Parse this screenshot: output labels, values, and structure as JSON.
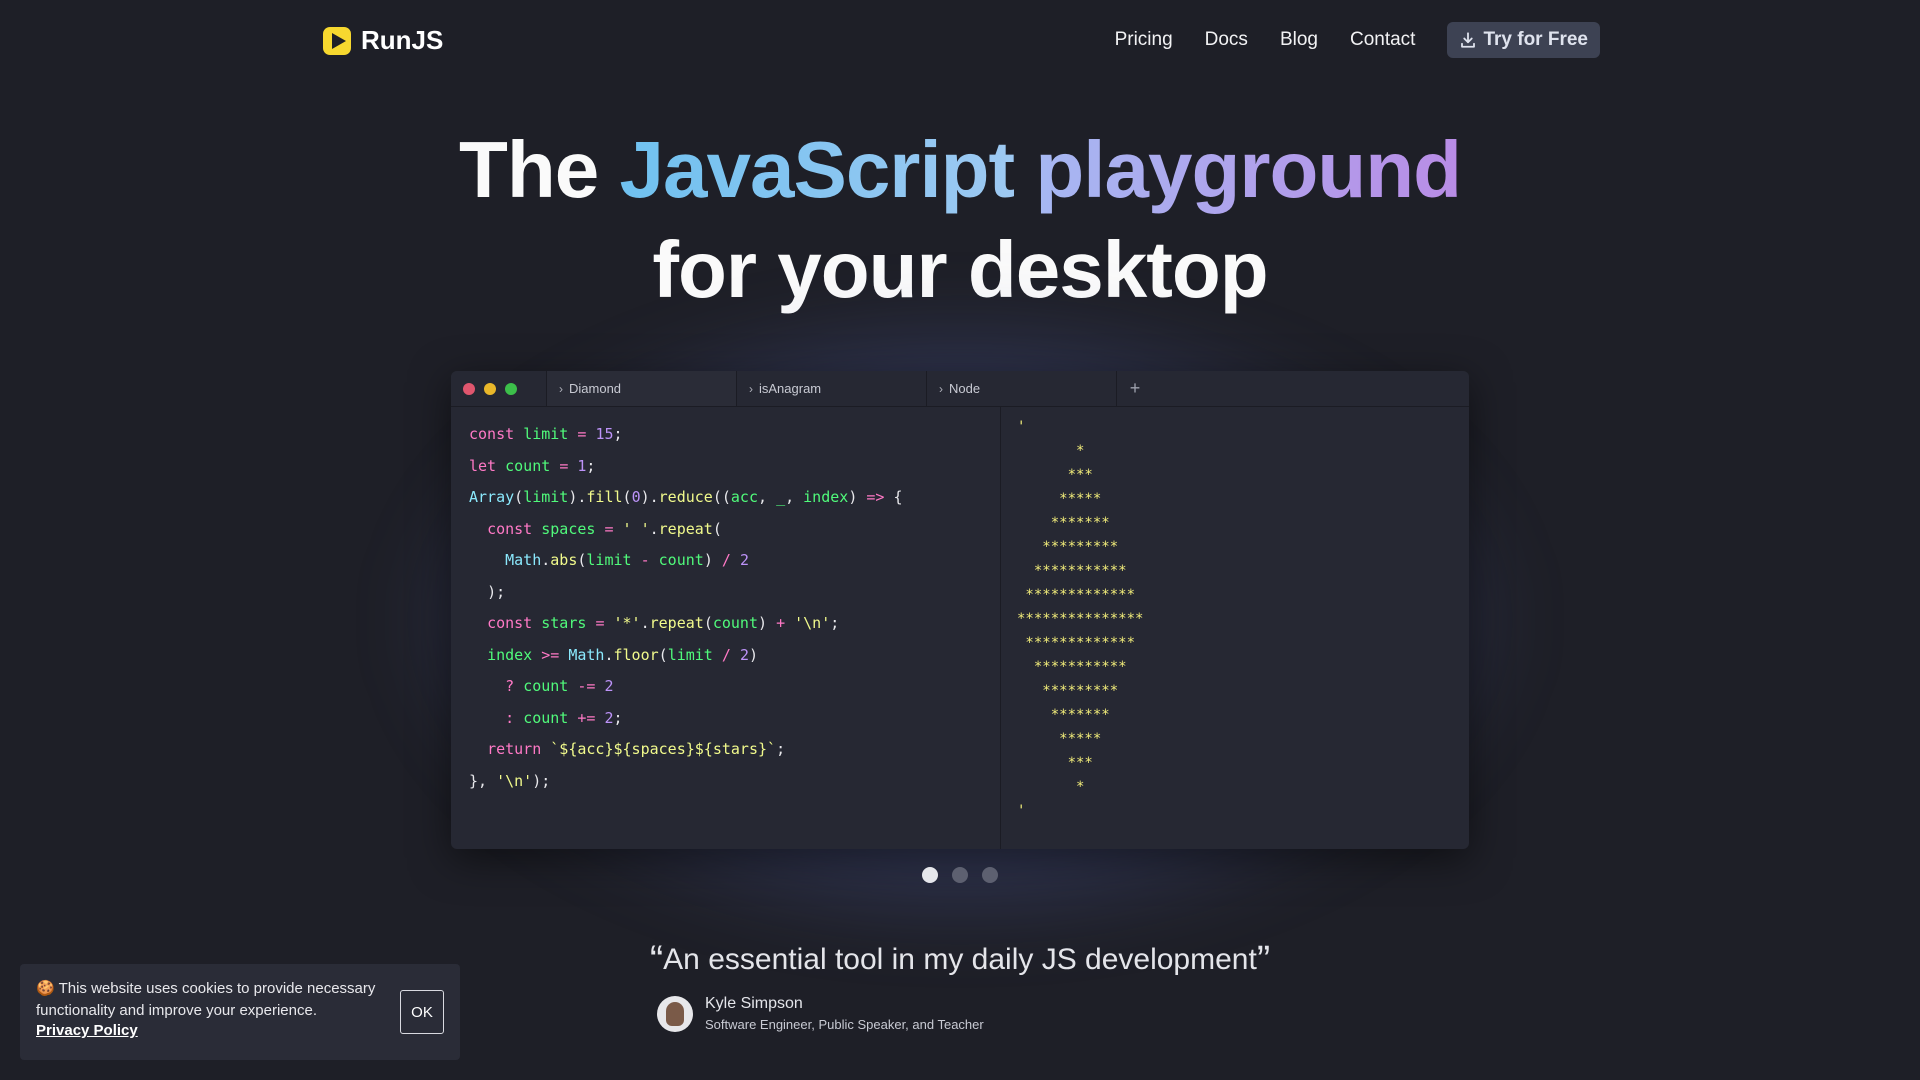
{
  "brand": {
    "name": "RunJS"
  },
  "nav": {
    "links": [
      "Pricing",
      "Docs",
      "Blog",
      "Contact"
    ],
    "cta": "Try for Free"
  },
  "hero": {
    "line1_start": "The ",
    "line1_js": "JavaScript",
    "line1_space": " ",
    "line1_pg": "playground",
    "line2": "for your desktop"
  },
  "app": {
    "window_dots": [
      "#f25f5c",
      "#f6bd29",
      "#3ec44a"
    ],
    "tabs": [
      "Diamond",
      "isAnagram",
      "Node"
    ],
    "add_tab": "+",
    "code_lines": [
      "const limit = 15;",
      "let count = 1;",
      "Array(limit).fill(0).reduce((acc, _, index) => {",
      "  const spaces = ' '.repeat(",
      "    Math.abs(limit - count) / 2",
      "  );",
      "  const stars = '*'.repeat(count) + '\\n';",
      "  index >= Math.floor(limit / 2)",
      "    ? count -= 2",
      "    : count += 2;",
      "  return `${acc}${spaces}${stars}`;",
      "}, '\\n');"
    ],
    "output_lines": [
      "'",
      "       *",
      "      ***",
      "     *****",
      "    *******",
      "   *********",
      "  ***********",
      " *************",
      "***************",
      " *************",
      "  ***********",
      "   *********",
      "    *******",
      "     *****",
      "      ***",
      "       *",
      "'"
    ]
  },
  "carousel": {
    "count": 3,
    "active": 0
  },
  "testimonial": {
    "open_quote": "“",
    "text": "An essential tool in my daily JS development",
    "close_quote": "”",
    "author": "Kyle Simpson",
    "role": "Software Engineer, Public Speaker, and Teacher"
  },
  "cookie": {
    "text": "🍪 This website uses cookies to provide necessary functionality and improve your experience.",
    "link": "Privacy Policy",
    "ok": "OK"
  }
}
